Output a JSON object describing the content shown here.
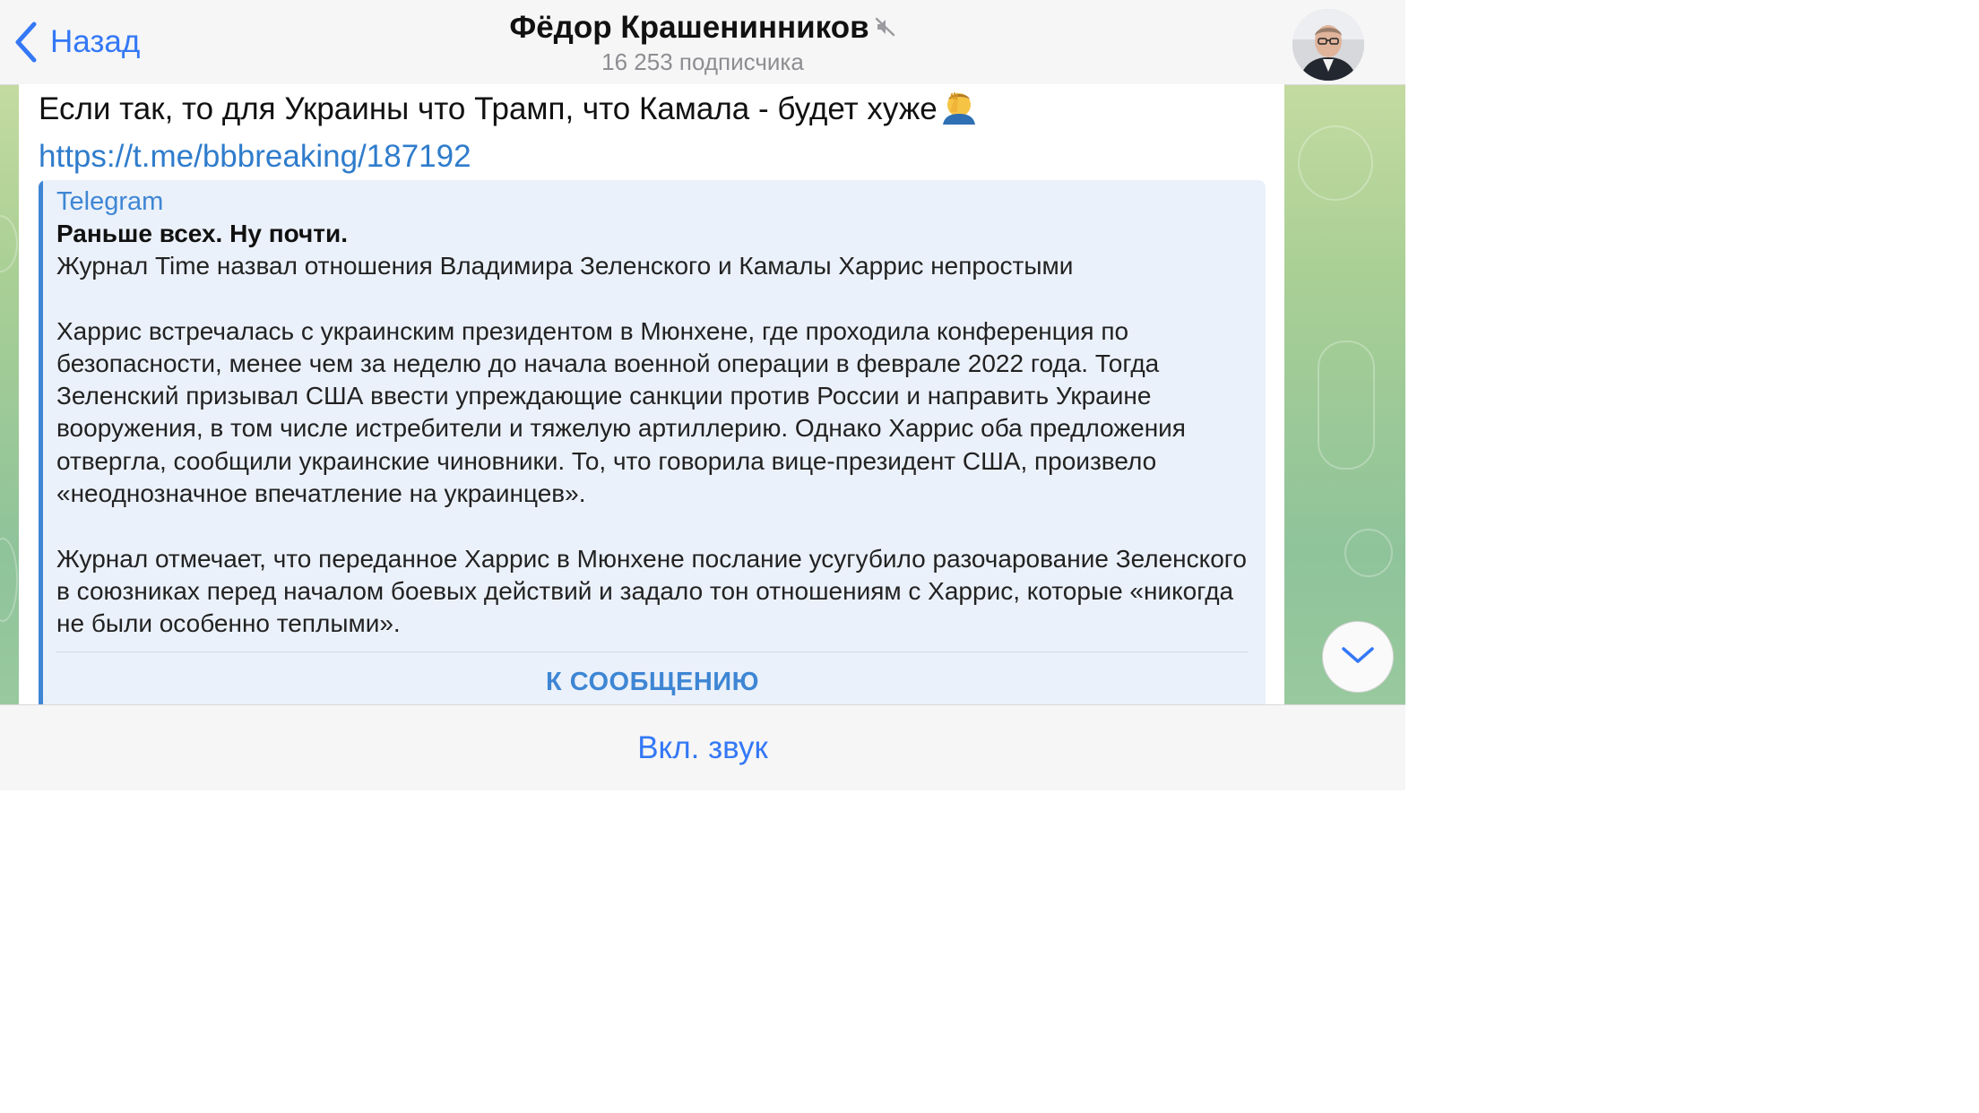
{
  "header": {
    "back_label": "Назад",
    "channel_title": "Фёдор Крашенинников",
    "subscriber_count": "16 253 подписчика"
  },
  "message": {
    "text_before_emoji": "Если так, то для Украины что Трамп, что Камала - будет хуже",
    "link_text": "https://t.me/bbbreaking/187192",
    "preview": {
      "site_name": "Telegram",
      "title": "Раньше всех. Ну почти.",
      "paragraphs": [
        "Журнал Time назвал отношения Владимира Зеленского и Камалы Харрис непростыми",
        "Харрис встречалась с украинским президентом в Мюнхене, где проходила конференция по безопасности, менее чем за неделю до начала военной операции в феврале 2022 года. Тогда Зеленский призывал США ввести упреждающие санкции против России и направить Украине вооружения, в том числе истребители и тяжелую артиллерию. Однако Харрис оба предложения отвергла, сообщили украинские чиновники. То, что говорила вице-президент США, произвело «неоднозначное впечатление на украинцев».",
        "Журнал отмечает, что переданное Харрис в Мюнхене послание усугубило разочарование Зеленского в союзниках перед началом боевых действий и задало тон отношениям с Харрис, которые «никогда не были особенно теплыми»."
      ],
      "button_label": "К СООБЩЕНИЮ"
    }
  },
  "bottom_bar": {
    "unmute_label": "Вкл. звук"
  },
  "icons": {
    "back": "chevron-left-icon",
    "mute": "muted-speaker-icon",
    "emoji": "facepalm-emoji",
    "scroll": "chevron-down-icon"
  },
  "colors": {
    "accent": "#3478f6",
    "link": "#2f7ccc",
    "preview_accent": "#3e86d4",
    "preview_background": "#ebf1fa",
    "bar_background": "#f6f6f6"
  }
}
